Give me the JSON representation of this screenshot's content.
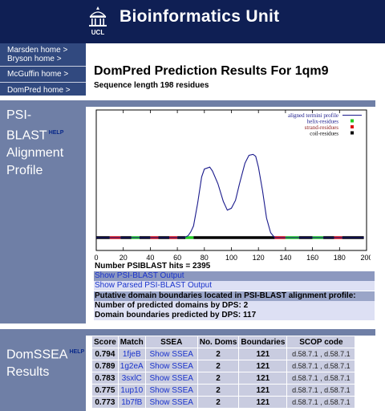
{
  "header": {
    "title": "Bioinformatics Unit",
    "logo_text": "UCL"
  },
  "nav": {
    "items": [
      "Marsden home >",
      "Bryson home >",
      "McGuffin home >",
      "DomPred home >"
    ]
  },
  "page": {
    "title": "DomPred Prediction Results For 1qm9",
    "subtitle": "Sequence length 198 residues"
  },
  "psiblast": {
    "label_lines": [
      "PSI-BLAST",
      "Alignment",
      "Profile"
    ],
    "help": "HELP",
    "hits": "Number PSIBLAST hits = 2395",
    "show_output": "Show PSI-BLAST Output",
    "show_parsed": "Show Parsed PSI-BLAST Output",
    "putative": "Putative domain boundaries located in PSI-BLAST alignment profile:",
    "num_domains": "Number of predicted domains by DPS: 2",
    "boundaries": "Domain boundaries predicted by DPS: 117"
  },
  "chart_data": {
    "type": "line",
    "xlim": [
      0,
      200
    ],
    "ylim": [
      0,
      1
    ],
    "xticks": [
      0,
      20,
      40,
      60,
      80,
      100,
      120,
      140,
      160,
      180,
      200
    ],
    "legend_position": "top-right",
    "legend": [
      {
        "label": "aligned termini profile",
        "color": "#1a1a8c",
        "kind": "line"
      },
      {
        "label": "helix-residues",
        "color": "#22cc22",
        "kind": "point"
      },
      {
        "label": "strand-residues",
        "color": "#dd1111",
        "kind": "point"
      },
      {
        "label": "coil-residues",
        "color": "#000000",
        "kind": "point"
      }
    ],
    "profile": {
      "x": [
        0,
        65,
        68,
        70,
        72,
        75,
        78,
        80,
        84,
        86,
        90,
        94,
        97,
        100,
        103,
        106,
        110,
        113,
        116,
        118,
        120,
        123,
        126,
        129,
        132,
        135,
        198
      ],
      "y": [
        0,
        0,
        0.02,
        0.06,
        0.12,
        0.35,
        0.62,
        0.7,
        0.72,
        0.68,
        0.55,
        0.37,
        0.28,
        0.3,
        0.38,
        0.55,
        0.76,
        0.84,
        0.85,
        0.83,
        0.72,
        0.48,
        0.2,
        0.05,
        0,
        0,
        0
      ]
    },
    "residue_segments": [
      {
        "start": 0,
        "end": 10,
        "type": "coil"
      },
      {
        "start": 10,
        "end": 18,
        "type": "strand"
      },
      {
        "start": 18,
        "end": 26,
        "type": "coil"
      },
      {
        "start": 26,
        "end": 32,
        "type": "helix"
      },
      {
        "start": 32,
        "end": 40,
        "type": "coil"
      },
      {
        "start": 40,
        "end": 46,
        "type": "strand"
      },
      {
        "start": 46,
        "end": 54,
        "type": "coil"
      },
      {
        "start": 54,
        "end": 60,
        "type": "strand"
      },
      {
        "start": 60,
        "end": 66,
        "type": "coil"
      },
      {
        "start": 66,
        "end": 72,
        "type": "helix"
      },
      {
        "start": 72,
        "end": 132,
        "type": "coil"
      },
      {
        "start": 132,
        "end": 140,
        "type": "strand"
      },
      {
        "start": 140,
        "end": 150,
        "type": "helix"
      },
      {
        "start": 150,
        "end": 160,
        "type": "coil"
      },
      {
        "start": 160,
        "end": 168,
        "type": "helix"
      },
      {
        "start": 168,
        "end": 176,
        "type": "coil"
      },
      {
        "start": 176,
        "end": 182,
        "type": "strand"
      },
      {
        "start": 182,
        "end": 198,
        "type": "coil"
      }
    ]
  },
  "domssea": {
    "label_lines": [
      "DomSSEA",
      "Results"
    ],
    "help": "HELP",
    "columns": [
      "Score",
      "Match",
      "SSEA",
      "No. Doms",
      "Boundaries",
      "SCOP code"
    ],
    "rows": [
      {
        "score": "0.794",
        "match": "1fjeB",
        "ssea": "Show SSEA",
        "doms": "2",
        "boundaries": "121",
        "scop": "d.58.7.1 , d.58.7.1"
      },
      {
        "score": "0.789",
        "match": "1g2eA",
        "ssea": "Show SSEA",
        "doms": "2",
        "boundaries": "121",
        "scop": "d.58.7.1 , d.58.7.1"
      },
      {
        "score": "0.783",
        "match": "3sxlC",
        "ssea": "Show SSEA",
        "doms": "2",
        "boundaries": "121",
        "scop": "d.58.7.1 , d.58.7.1"
      },
      {
        "score": "0.775",
        "match": "1up10",
        "ssea": "Show SSEA",
        "doms": "2",
        "boundaries": "121",
        "scop": "d.58.7.1 , d.58.7.1"
      },
      {
        "score": "0.773",
        "match": "1b7fB",
        "ssea": "Show SSEA",
        "doms": "2",
        "boundaries": "121",
        "scop": "d.58.7.1 , d.58.7.1"
      }
    ]
  }
}
